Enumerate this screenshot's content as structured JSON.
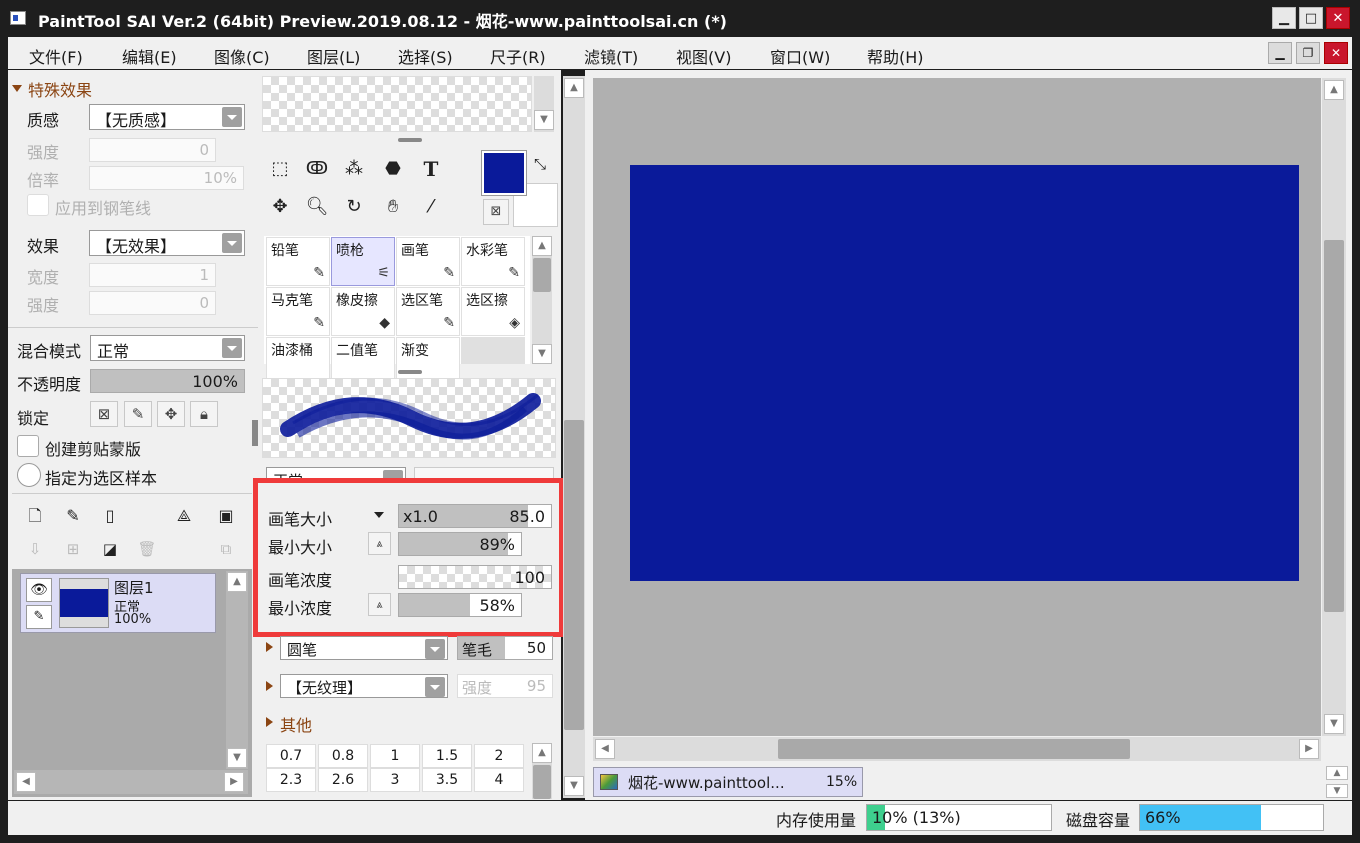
{
  "window": {
    "title": "PaintTool SAI Ver.2 (64bit) Preview.2019.08.12 - 烟花-www.painttoolsai.cn (*)"
  },
  "menu": [
    "文件(F)",
    "编辑(E)",
    "图像(C)",
    "图层(L)",
    "选择(S)",
    "尺子(R)",
    "滤镜(T)",
    "视图(V)",
    "窗口(W)",
    "帮助(H)"
  ],
  "effects": {
    "section_title": "特殊效果",
    "texture_label": "质感",
    "texture_value": "【无质感】",
    "strength_label": "强度",
    "strength_value": "0",
    "scale_label": "倍率",
    "scale_value": "10%",
    "apply_line_label": "应用到钢笔线",
    "effect_label": "效果",
    "effect_value": "【无效果】",
    "width_label": "宽度",
    "width_value": "1",
    "strength2_label": "强度",
    "strength2_value": "0"
  },
  "layer_props": {
    "blend_label": "混合模式",
    "blend_value": "正常",
    "opacity_label": "不透明度",
    "opacity_value": "100%",
    "opacity_fraction": 1.0,
    "lock_label": "锁定",
    "clip_label": "创建剪贴蒙版",
    "sample_label": "指定为选区样本"
  },
  "layers": [
    {
      "name": "图层1",
      "mode": "正常",
      "opacity": "100%",
      "thumb_color": "#0a1a9a"
    }
  ],
  "colors": {
    "primary": "#0a1a9a",
    "secondary": "#ffffff",
    "canvas": "#0a1a9a",
    "highlight": "#ef3a3a",
    "memory_fill": "#3ecf8e",
    "disk_fill": "#42c1f5"
  },
  "tools": {
    "text_tool": "T"
  },
  "brushes": [
    {
      "name": "铅笔",
      "icon": "✎",
      "selected": false
    },
    {
      "name": "喷枪",
      "icon": "⚟",
      "selected": true
    },
    {
      "name": "画笔",
      "icon": "✎",
      "selected": false
    },
    {
      "name": "水彩笔",
      "icon": "✎",
      "selected": false
    },
    {
      "name": "马克笔",
      "icon": "✎",
      "selected": false
    },
    {
      "name": "橡皮擦",
      "icon": "◆",
      "selected": false
    },
    {
      "name": "选区笔",
      "icon": "✎",
      "selected": false
    },
    {
      "name": "选区擦",
      "icon": "◈",
      "selected": false
    },
    {
      "name": "油漆桶",
      "icon": "",
      "selected": false
    },
    {
      "name": "二值笔",
      "icon": "",
      "selected": false
    },
    {
      "name": "渐变",
      "icon": "",
      "selected": false
    }
  ],
  "brush_settings": {
    "mode_value": "正常",
    "size_label": "画笔大小",
    "size_multiplier": "x1.0",
    "size_value": "85.0",
    "size_fraction": 0.85,
    "min_size_label": "最小大小",
    "min_size_value": "89%",
    "min_size_fraction": 0.89,
    "density_label": "画笔浓度",
    "density_value": "100",
    "density_fraction": 1.0,
    "min_density_label": "最小浓度",
    "min_density_value": "58%",
    "min_density_fraction": 0.58,
    "shape_value": "圆笔",
    "shape_param_label": "笔毛",
    "shape_param_value": "50",
    "texture_value": "【无纹理】",
    "texture_strength_label": "强度",
    "texture_strength_value": "95",
    "other_label": "其他"
  },
  "size_presets": [
    [
      "0.7",
      "0.8",
      "1",
      "1.5",
      "2"
    ],
    [
      "2.3",
      "2.6",
      "3",
      "3.5",
      "4"
    ]
  ],
  "document_tab": {
    "name": "烟花-www.painttool...",
    "zoom": "15%"
  },
  "status": {
    "memory_label": "内存使用量",
    "memory_value": "10% (13%)",
    "memory_fraction": 0.1,
    "disk_label": "磁盘容量",
    "disk_value": "66%",
    "disk_fraction": 0.66
  }
}
